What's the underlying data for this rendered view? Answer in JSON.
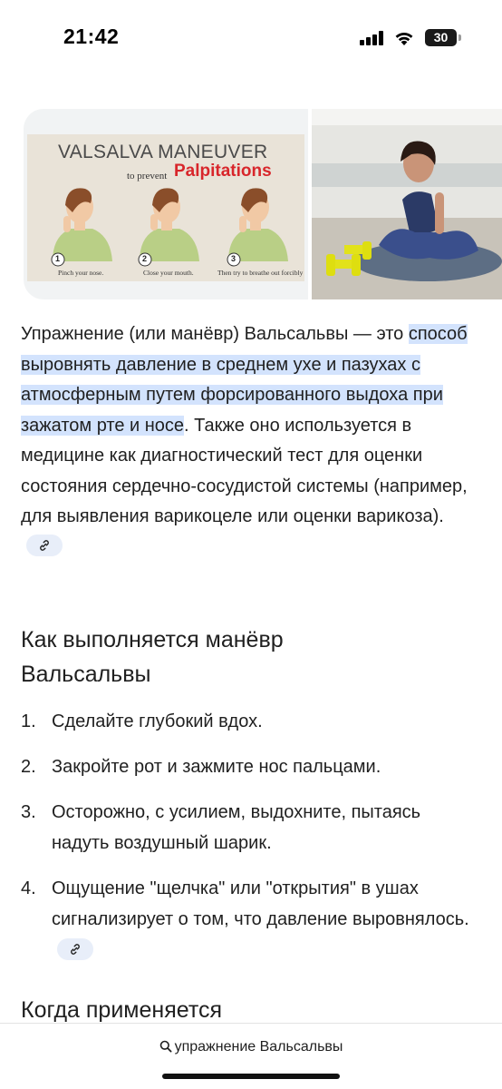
{
  "status": {
    "time": "21:42",
    "battery": "30"
  },
  "images": {
    "left_title": "VALSALVA MANEUVER",
    "left_sub": "to prevent",
    "left_red": "Palpitations",
    "captions": [
      "Pinch your nose.",
      "Close your mouth.",
      "Then try to breathe out forcibly"
    ],
    "step_numbers": [
      "1",
      "2",
      "3"
    ]
  },
  "article": {
    "intro_start": "Упражнение (или манёвр) Вальсальвы — это",
    "intro_highlight": "способ выровнять давление в среднем ухе и пазухах с атмосферным путем форсированного выдоха при зажатом рте и носе",
    "intro_rest": ". Также оно используется в медицине как диагностический тест для оценки состояния сердечно-сосудистой системы (например, для выявления варикоцеле или оценки варикоза).",
    "section1_title": "Как выполняется манёвр Вальсальвы",
    "steps": [
      "Сделайте глубокий вдох.",
      "Закройте рот и зажмите нос пальцами.",
      "Осторожно, с усилием, выдохните, пытаясь надуть воздушный шарик.",
      "Ощущение \"щелчка\" или \"открытия\" в ушах сигнализирует о том, что давление выровнялось."
    ],
    "step_numbers": [
      "1.",
      "2.",
      "3.",
      "4."
    ],
    "section2_title": "Когда применяется"
  },
  "bottom": {
    "query": "упражнение Вальсальвы"
  },
  "colors": {
    "highlight": "#d3e3fd",
    "link_chip": "#e8eef9",
    "accent_red": "#d8262b"
  }
}
